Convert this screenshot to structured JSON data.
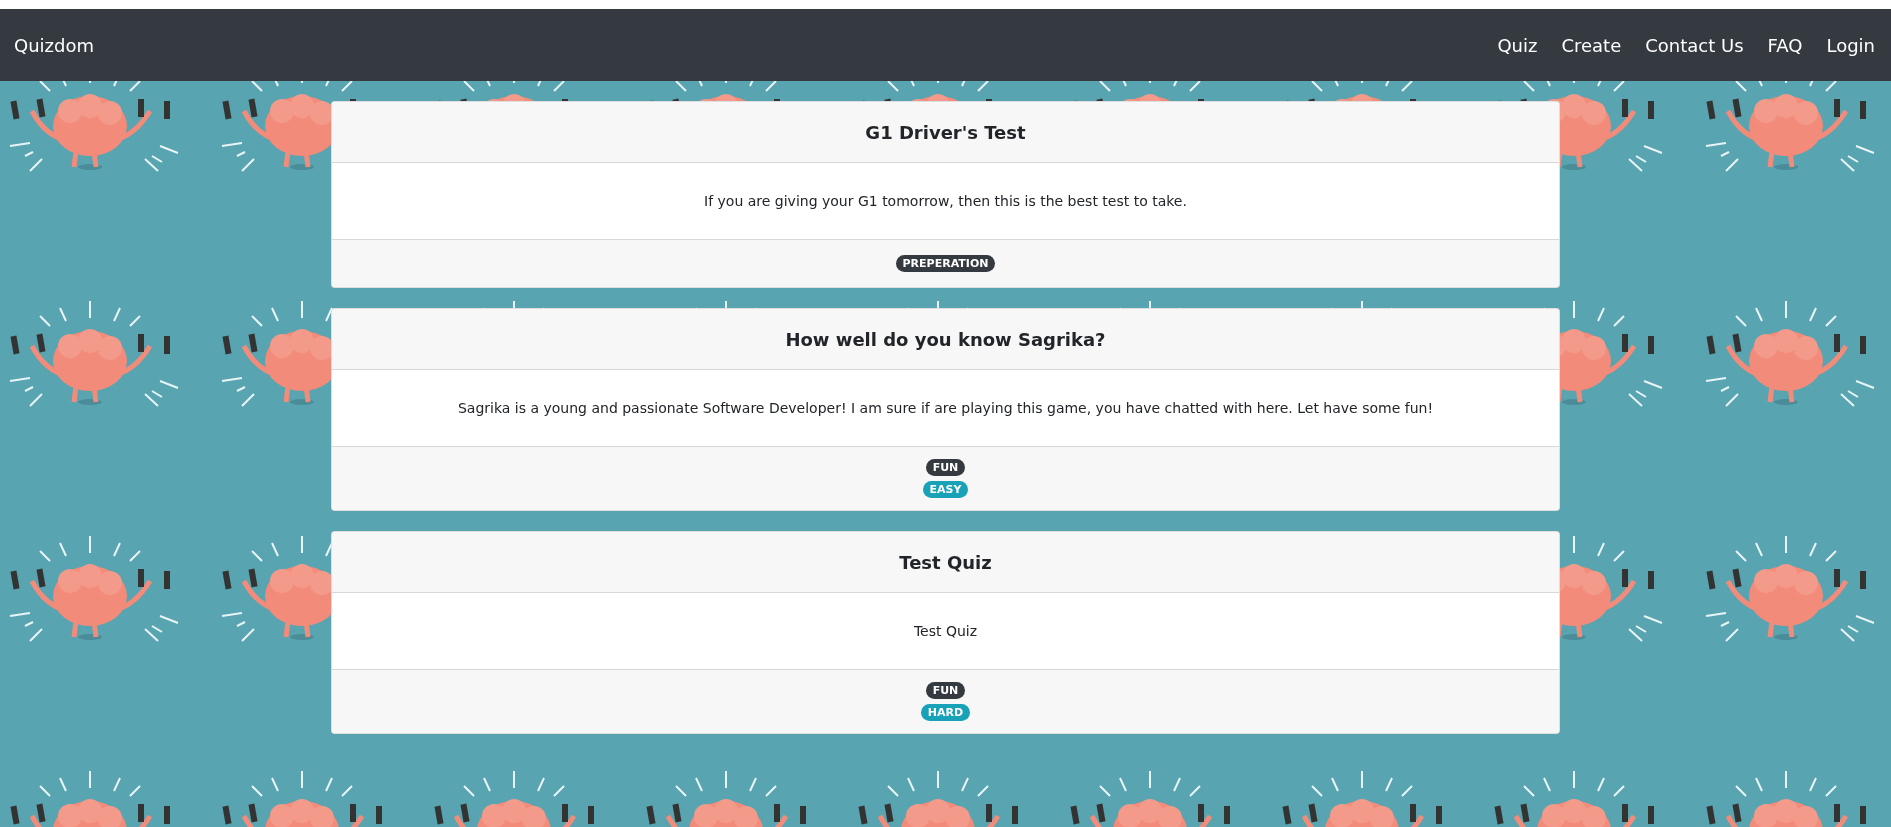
{
  "navbar": {
    "brand": "Quizdom",
    "links": [
      "Quiz",
      "Create",
      "Contact Us",
      "FAQ",
      "Login"
    ]
  },
  "quizzes": [
    {
      "title": "G1 Driver's Test",
      "description": "If you are giving your G1 tomorrow, then this is the best test to take.",
      "tags": [
        {
          "label": "PREPERATION",
          "kind": "dark"
        }
      ]
    },
    {
      "title": "How well do you know Sagrika?",
      "description": "Sagrika is a young and passionate Software Developer! I am sure if are playing this game, you have chatted with here. Let have some fun!",
      "tags": [
        {
          "label": "FUN",
          "kind": "dark"
        },
        {
          "label": "EASY",
          "kind": "info"
        }
      ]
    },
    {
      "title": "Test Quiz",
      "description": "Test Quiz",
      "tags": [
        {
          "label": "FUN",
          "kind": "dark"
        },
        {
          "label": "HARD",
          "kind": "info"
        }
      ]
    }
  ]
}
